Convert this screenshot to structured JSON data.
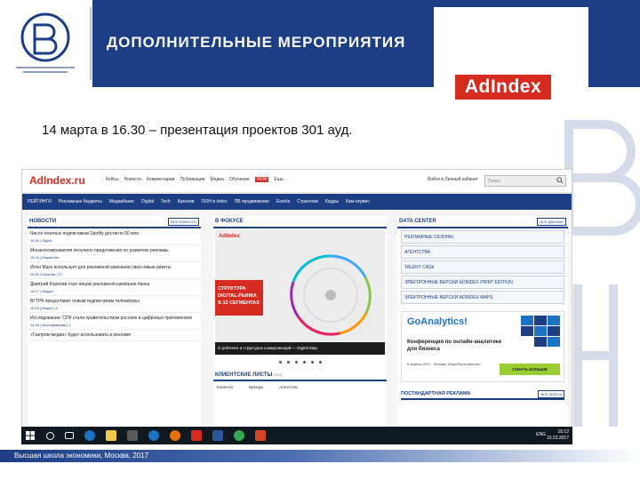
{
  "slide": {
    "title": "ДОПОЛНИТЕЛЬНЫЕ МЕРОПРИЯТИЯ",
    "partner_logo": "AdIndex",
    "subtitle": "14 марта в 16.30 – презентация проектов 301 ауд.",
    "footer": "Высшая школа экономики, Москва, 2017"
  },
  "site": {
    "logo": "AdIndex.ru",
    "top_nav": [
      "Кейсы",
      "Новости",
      "Комментарии",
      "Публикации",
      "Медиа",
      "Обучение",
      "NEW",
      "Еще..."
    ],
    "login": "Войти в Личный кабинет",
    "search_placeholder": "Поиск",
    "main_nav": [
      "РЕЙТИНГИ",
      "Рекламные бюджеты",
      "Медиабаинг",
      "Digital",
      "Tech",
      "Креатив",
      "ООН в Index",
      "ПВ продвижение",
      "Events",
      "Стратегии",
      "Кадры",
      "Кам-сервис"
    ],
    "news": {
      "header": "НОВОСТИ",
      "button": "ВСЕ НОВОСТИ",
      "items": [
        {
          "headline": "Число платных подписчиков Spotify достигло 50 млн",
          "meta": "16:54 | Digital"
        },
        {
          "headline": "Минэкономразвития получило предложения по развитию рекламы",
          "meta": "16:34 | Маркетинг"
        },
        {
          "headline": "Илон Маск использует для рекламной кампании свои новые ракеты",
          "meta": "15:52 | Креатив | 12"
        },
        {
          "headline": "Дмитрий Королев стал лицом рекламной кампании банка",
          "meta": "15:27 | Медиа"
        },
        {
          "headline": "ВГТРК предоставит новым подписчикам телевизоры",
          "meta": "15:10 | Медиа | 2"
        },
        {
          "headline": "Исследование: СПК стали правительством россиян в цифровых приложениях",
          "meta": "14:46 | Исследования | 1"
        },
        {
          "headline": "«Газпром-медиа» будет использовать в рекламе",
          "meta": "14:35 | Медиа"
        }
      ]
    },
    "focus": {
      "header": "В ФОКУСЕ",
      "banner_logo": "AdIndex",
      "banner_text": "СТРУКТУРА DIGITAL-РЫНКА В 12 СЕГМЕНТАХ",
      "caption": "О рейтинге и структурах коммуникаций — Digital Map"
    },
    "clients": {
      "header": "КЛИЕНТСКИЕ ЛИСТЫ",
      "year": "2016",
      "tabs": [
        "Клиенты",
        "Бренды",
        "Агентство"
      ]
    },
    "data_center": {
      "header": "DATA CENTER",
      "button": "ВСЕ ДАННЫЕ",
      "items": [
        "РЕКЛАМНЫЕ СЕЗОНЫ",
        "АГЕНТСТВА",
        "TALENT CASE",
        "ЭЛЕКТРОННЫЕ ВЕРСИИ ADINDEX PRINT EDITION",
        "ЭЛЕКТРОННЫЕ ВЕРСИИ ADINDEX MAPS"
      ]
    },
    "ga_ad": {
      "logo": "GoAnalytics!",
      "text": "Конференция по онлайн-аналитике для бизнеса",
      "date": "6 апреля 2017 · Москва, ИнфоПространство",
      "button": "УЗНАТЬ БОЛЬШЕ"
    },
    "ad_section": {
      "header": "ПОСТАНДАРТНАЯ РЕКЛАМА",
      "button": "ВСЕ КЕЙСЫ"
    }
  },
  "taskbar": {
    "lang": "ENG",
    "time": "16:12",
    "date": "10.03.2017"
  },
  "colors": {
    "brand_blue": "#1b3e85",
    "brand_red": "#d62b21"
  }
}
